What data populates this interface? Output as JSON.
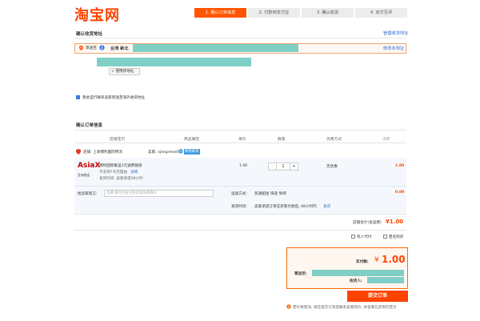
{
  "header": {
    "logo": "淘宝网",
    "steps": [
      "1. 确认订单信息",
      "2. 付款到支付宝",
      "3. 确认收货",
      "4. 双方互评"
    ],
    "active_step": 0
  },
  "address": {
    "title": "确认收货地址",
    "manage_link": "管理收货地址",
    "ship_to_label": "寄送至",
    "province": "台湾 新北",
    "modify_link": "修改本地址",
    "use_new_button": "使用新地址",
    "checkbox_label": "我会自行联系卖家寄送至海外收货地址",
    "checkbox_checked": true
  },
  "order": {
    "title": "确认订单信息",
    "columns": [
      "店铺宝贝",
      "商品属性",
      "单价",
      "数量",
      "优惠方式",
      "小计"
    ],
    "shop_label": "店铺: 上海博利国际物流",
    "seller_label": "卖家: xjiexpress0",
    "contact_label": "和我联系",
    "item": {
      "brand": "AsiaX",
      "brand_sub": "亚洲快运",
      "name": "博利国际集运1元速费链接",
      "note": "不支持7天无理由",
      "detail_link": "详情",
      "ship_time": "发货时间: 卖家承诺48小时",
      "unit_price": "1.00",
      "qty_minus": "-",
      "qty": "1",
      "qty_plus": "+",
      "discount": "无优惠",
      "subtotal": "1.00"
    },
    "message_label": "给卖家留言:",
    "message_placeholder": "选填:填写内容已和卖家协商确认",
    "shipping_label": "运送方式:",
    "shipping_value": "普通配送 快递 免邮",
    "shipping_fee": "0.00",
    "invoice_label": "发货时间:",
    "invoice_value": "卖家承诺订单在买家付款后, 48小时内",
    "invoice_link": "发货",
    "shop_total_label": "店铺合计(含运费)",
    "shop_total": "¥1.00",
    "proxy_pay_label": "找人代付",
    "anon_buy_label": "匿名购买"
  },
  "confirm": {
    "paid_label": "实付款:",
    "paid_currency": "¥",
    "paid_amount": "1.00",
    "ship_to_label": "寄送至:",
    "receiver_label": "收货人:",
    "submit_button": "提交订单",
    "warning": "若价格变动, 请在提交订单后联系卖家改价, 并查看已买到的宝贝"
  },
  "colors": {
    "accent": "#ff4400",
    "link": "#3366cc",
    "redacted": "#7fcfc6"
  }
}
